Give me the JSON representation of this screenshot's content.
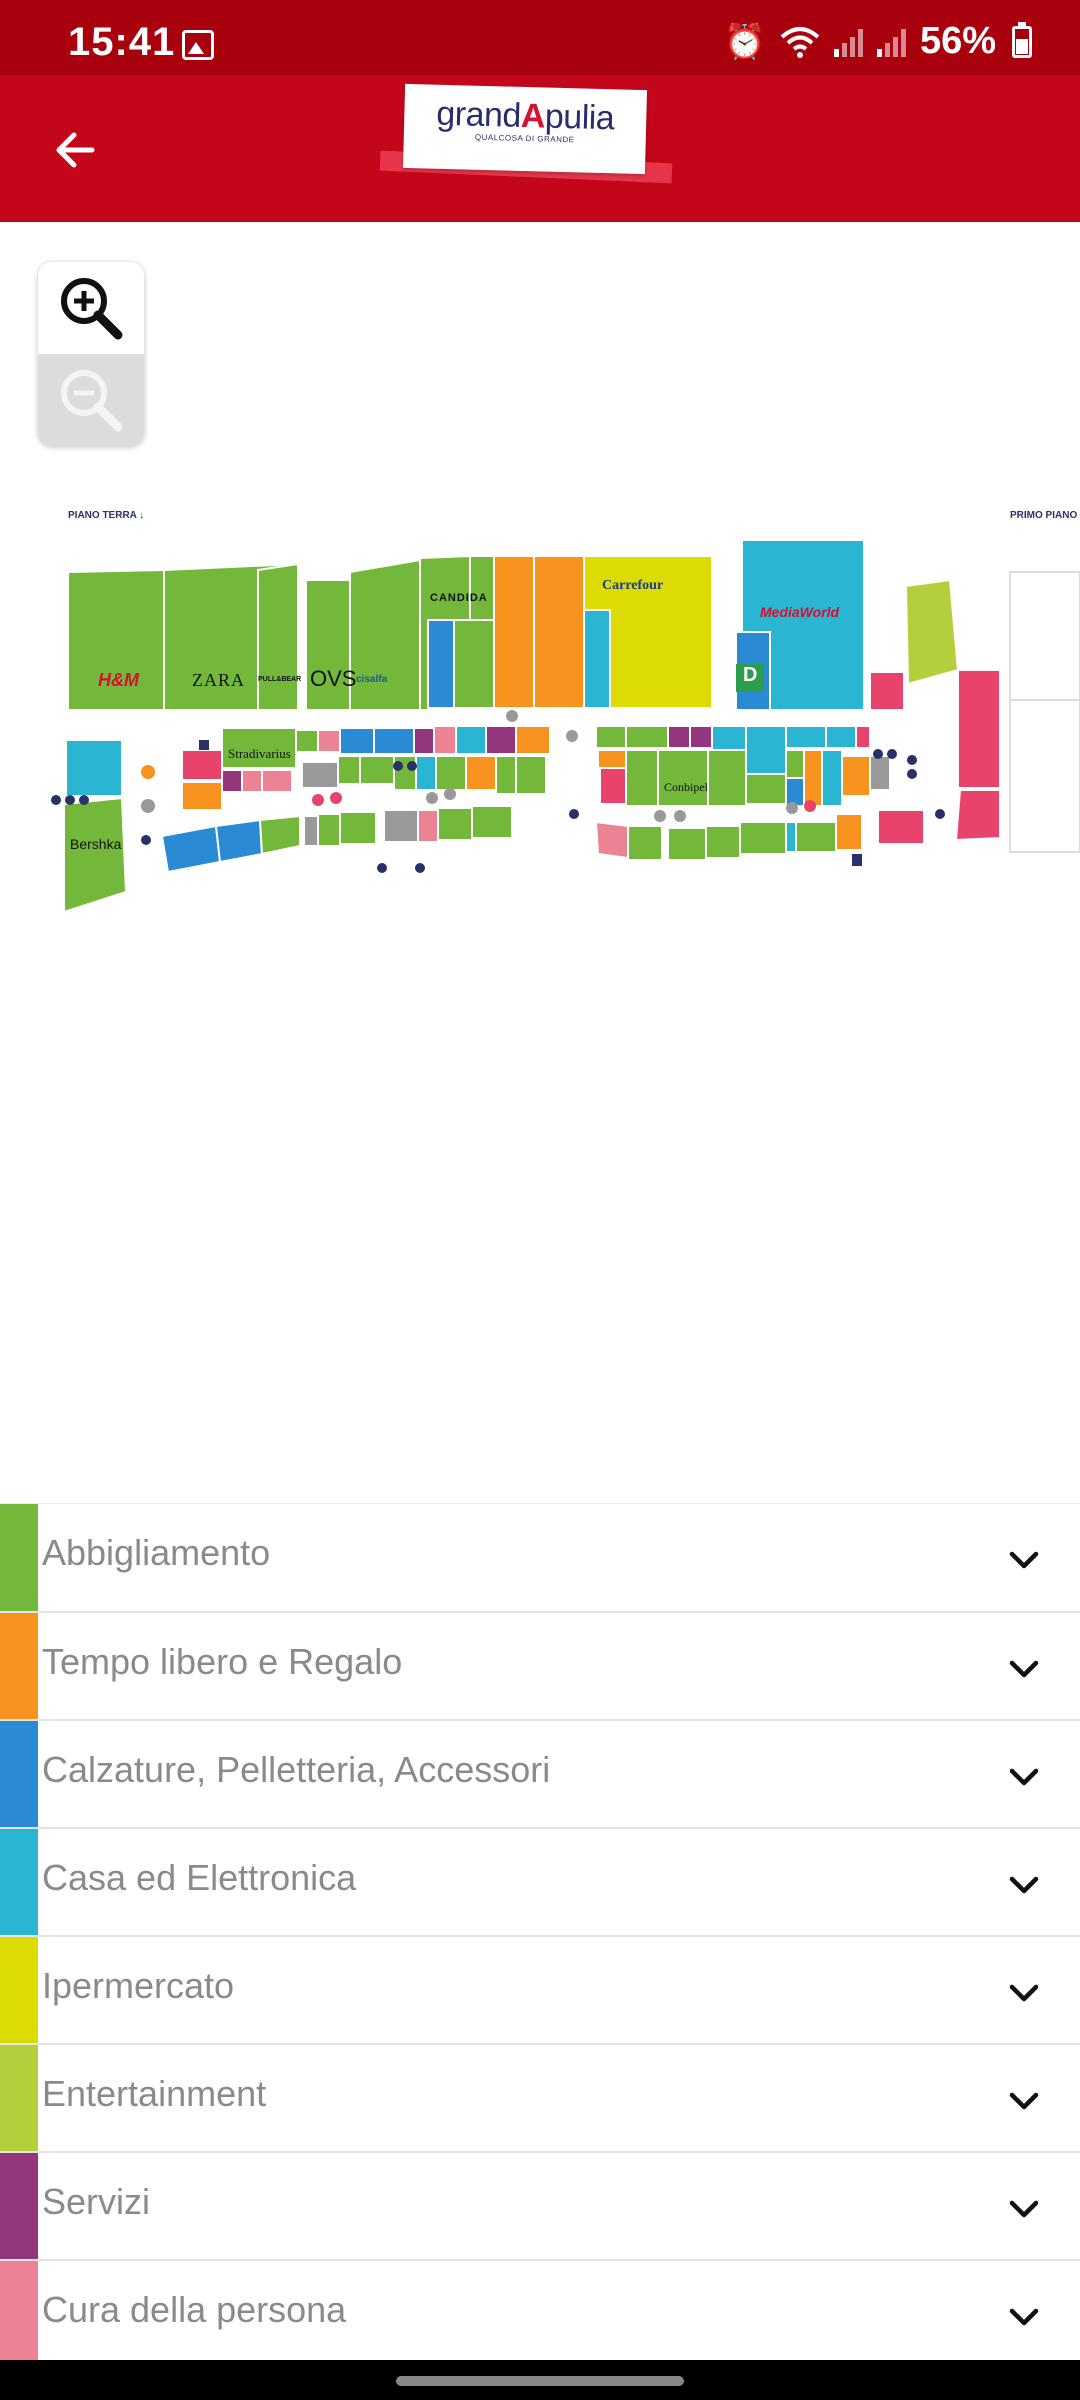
{
  "status_bar": {
    "time": "15:41",
    "battery": "56%",
    "icons": [
      "image-icon",
      "alarm-icon",
      "wifi-icon",
      "signal-icon",
      "signal-icon",
      "battery-icon"
    ]
  },
  "app_bar": {
    "back_icon": "arrow-left-icon",
    "logo": {
      "prefix": "grand",
      "accent": "A",
      "suffix": "pulia",
      "tagline": "QUALCOSA DI GRANDE"
    },
    "colors": {
      "status": "#a8000c",
      "bar": "#c4061a"
    }
  },
  "zoom": {
    "in_icon": "zoom-in-icon",
    "out_icon": "zoom-out-icon"
  },
  "map": {
    "floor_ground": "PIANO TERRA ↓",
    "floor_first": "PRIMO PIANO",
    "brands": {
      "hm": "H&M",
      "zara": "ZARA",
      "pullbear": "PULL&BEAR",
      "ovs": "OVS",
      "cisalfa": "cisalfa",
      "candida": "CANDIDA",
      "carrefour": "Carrefour",
      "mediaworld": "MediaWorld",
      "stradivarius": "Stradivarius",
      "bershka": "Bershka",
      "conbipel": "Conbipel",
      "decathlon": "D"
    }
  },
  "categories": [
    {
      "label": "Abbigliamento",
      "color": "#73b83a"
    },
    {
      "label": "Tempo libero e Regalo",
      "color": "#f7931e"
    },
    {
      "label": "Calzature, Pelletteria, Accessori",
      "color": "#2b8ad4"
    },
    {
      "label": "Casa ed Elettronica",
      "color": "#2ab5d3"
    },
    {
      "label": "Ipermercato",
      "color": "#dcdb04"
    },
    {
      "label": "Entertainment",
      "color": "#b3cf3c"
    },
    {
      "label": "Servizi",
      "color": "#94367d"
    },
    {
      "label": "Cura della persona",
      "color": "#ec8394"
    }
  ]
}
